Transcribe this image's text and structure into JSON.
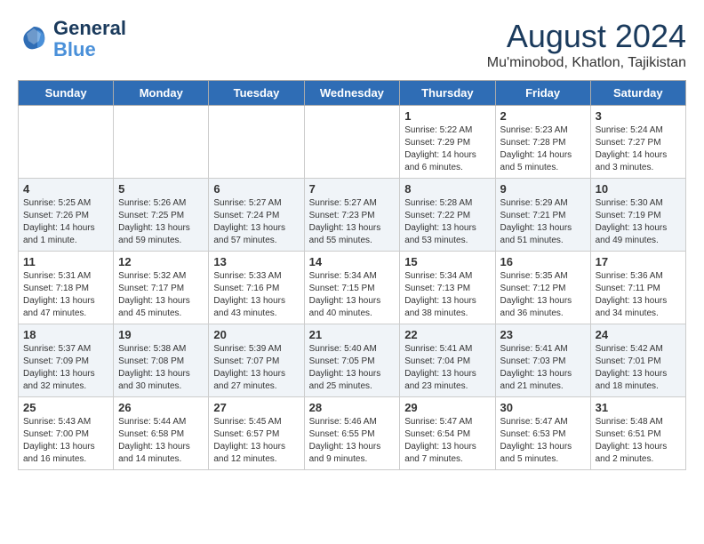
{
  "logo": {
    "line1": "General",
    "line2": "Blue"
  },
  "title": "August 2024",
  "subtitle": "Mu'minobod, Khatlon, Tajikistan",
  "headers": [
    "Sunday",
    "Monday",
    "Tuesday",
    "Wednesday",
    "Thursday",
    "Friday",
    "Saturday"
  ],
  "weeks": [
    [
      {
        "day": "",
        "info": ""
      },
      {
        "day": "",
        "info": ""
      },
      {
        "day": "",
        "info": ""
      },
      {
        "day": "",
        "info": ""
      },
      {
        "day": "1",
        "info": "Sunrise: 5:22 AM\nSunset: 7:29 PM\nDaylight: 14 hours\nand 6 minutes."
      },
      {
        "day": "2",
        "info": "Sunrise: 5:23 AM\nSunset: 7:28 PM\nDaylight: 14 hours\nand 5 minutes."
      },
      {
        "day": "3",
        "info": "Sunrise: 5:24 AM\nSunset: 7:27 PM\nDaylight: 14 hours\nand 3 minutes."
      }
    ],
    [
      {
        "day": "4",
        "info": "Sunrise: 5:25 AM\nSunset: 7:26 PM\nDaylight: 14 hours\nand 1 minute."
      },
      {
        "day": "5",
        "info": "Sunrise: 5:26 AM\nSunset: 7:25 PM\nDaylight: 13 hours\nand 59 minutes."
      },
      {
        "day": "6",
        "info": "Sunrise: 5:27 AM\nSunset: 7:24 PM\nDaylight: 13 hours\nand 57 minutes."
      },
      {
        "day": "7",
        "info": "Sunrise: 5:27 AM\nSunset: 7:23 PM\nDaylight: 13 hours\nand 55 minutes."
      },
      {
        "day": "8",
        "info": "Sunrise: 5:28 AM\nSunset: 7:22 PM\nDaylight: 13 hours\nand 53 minutes."
      },
      {
        "day": "9",
        "info": "Sunrise: 5:29 AM\nSunset: 7:21 PM\nDaylight: 13 hours\nand 51 minutes."
      },
      {
        "day": "10",
        "info": "Sunrise: 5:30 AM\nSunset: 7:19 PM\nDaylight: 13 hours\nand 49 minutes."
      }
    ],
    [
      {
        "day": "11",
        "info": "Sunrise: 5:31 AM\nSunset: 7:18 PM\nDaylight: 13 hours\nand 47 minutes."
      },
      {
        "day": "12",
        "info": "Sunrise: 5:32 AM\nSunset: 7:17 PM\nDaylight: 13 hours\nand 45 minutes."
      },
      {
        "day": "13",
        "info": "Sunrise: 5:33 AM\nSunset: 7:16 PM\nDaylight: 13 hours\nand 43 minutes."
      },
      {
        "day": "14",
        "info": "Sunrise: 5:34 AM\nSunset: 7:15 PM\nDaylight: 13 hours\nand 40 minutes."
      },
      {
        "day": "15",
        "info": "Sunrise: 5:34 AM\nSunset: 7:13 PM\nDaylight: 13 hours\nand 38 minutes."
      },
      {
        "day": "16",
        "info": "Sunrise: 5:35 AM\nSunset: 7:12 PM\nDaylight: 13 hours\nand 36 minutes."
      },
      {
        "day": "17",
        "info": "Sunrise: 5:36 AM\nSunset: 7:11 PM\nDaylight: 13 hours\nand 34 minutes."
      }
    ],
    [
      {
        "day": "18",
        "info": "Sunrise: 5:37 AM\nSunset: 7:09 PM\nDaylight: 13 hours\nand 32 minutes."
      },
      {
        "day": "19",
        "info": "Sunrise: 5:38 AM\nSunset: 7:08 PM\nDaylight: 13 hours\nand 30 minutes."
      },
      {
        "day": "20",
        "info": "Sunrise: 5:39 AM\nSunset: 7:07 PM\nDaylight: 13 hours\nand 27 minutes."
      },
      {
        "day": "21",
        "info": "Sunrise: 5:40 AM\nSunset: 7:05 PM\nDaylight: 13 hours\nand 25 minutes."
      },
      {
        "day": "22",
        "info": "Sunrise: 5:41 AM\nSunset: 7:04 PM\nDaylight: 13 hours\nand 23 minutes."
      },
      {
        "day": "23",
        "info": "Sunrise: 5:41 AM\nSunset: 7:03 PM\nDaylight: 13 hours\nand 21 minutes."
      },
      {
        "day": "24",
        "info": "Sunrise: 5:42 AM\nSunset: 7:01 PM\nDaylight: 13 hours\nand 18 minutes."
      }
    ],
    [
      {
        "day": "25",
        "info": "Sunrise: 5:43 AM\nSunset: 7:00 PM\nDaylight: 13 hours\nand 16 minutes."
      },
      {
        "day": "26",
        "info": "Sunrise: 5:44 AM\nSunset: 6:58 PM\nDaylight: 13 hours\nand 14 minutes."
      },
      {
        "day": "27",
        "info": "Sunrise: 5:45 AM\nSunset: 6:57 PM\nDaylight: 13 hours\nand 12 minutes."
      },
      {
        "day": "28",
        "info": "Sunrise: 5:46 AM\nSunset: 6:55 PM\nDaylight: 13 hours\nand 9 minutes."
      },
      {
        "day": "29",
        "info": "Sunrise: 5:47 AM\nSunset: 6:54 PM\nDaylight: 13 hours\nand 7 minutes."
      },
      {
        "day": "30",
        "info": "Sunrise: 5:47 AM\nSunset: 6:53 PM\nDaylight: 13 hours\nand 5 minutes."
      },
      {
        "day": "31",
        "info": "Sunrise: 5:48 AM\nSunset: 6:51 PM\nDaylight: 13 hours\nand 2 minutes."
      }
    ]
  ]
}
